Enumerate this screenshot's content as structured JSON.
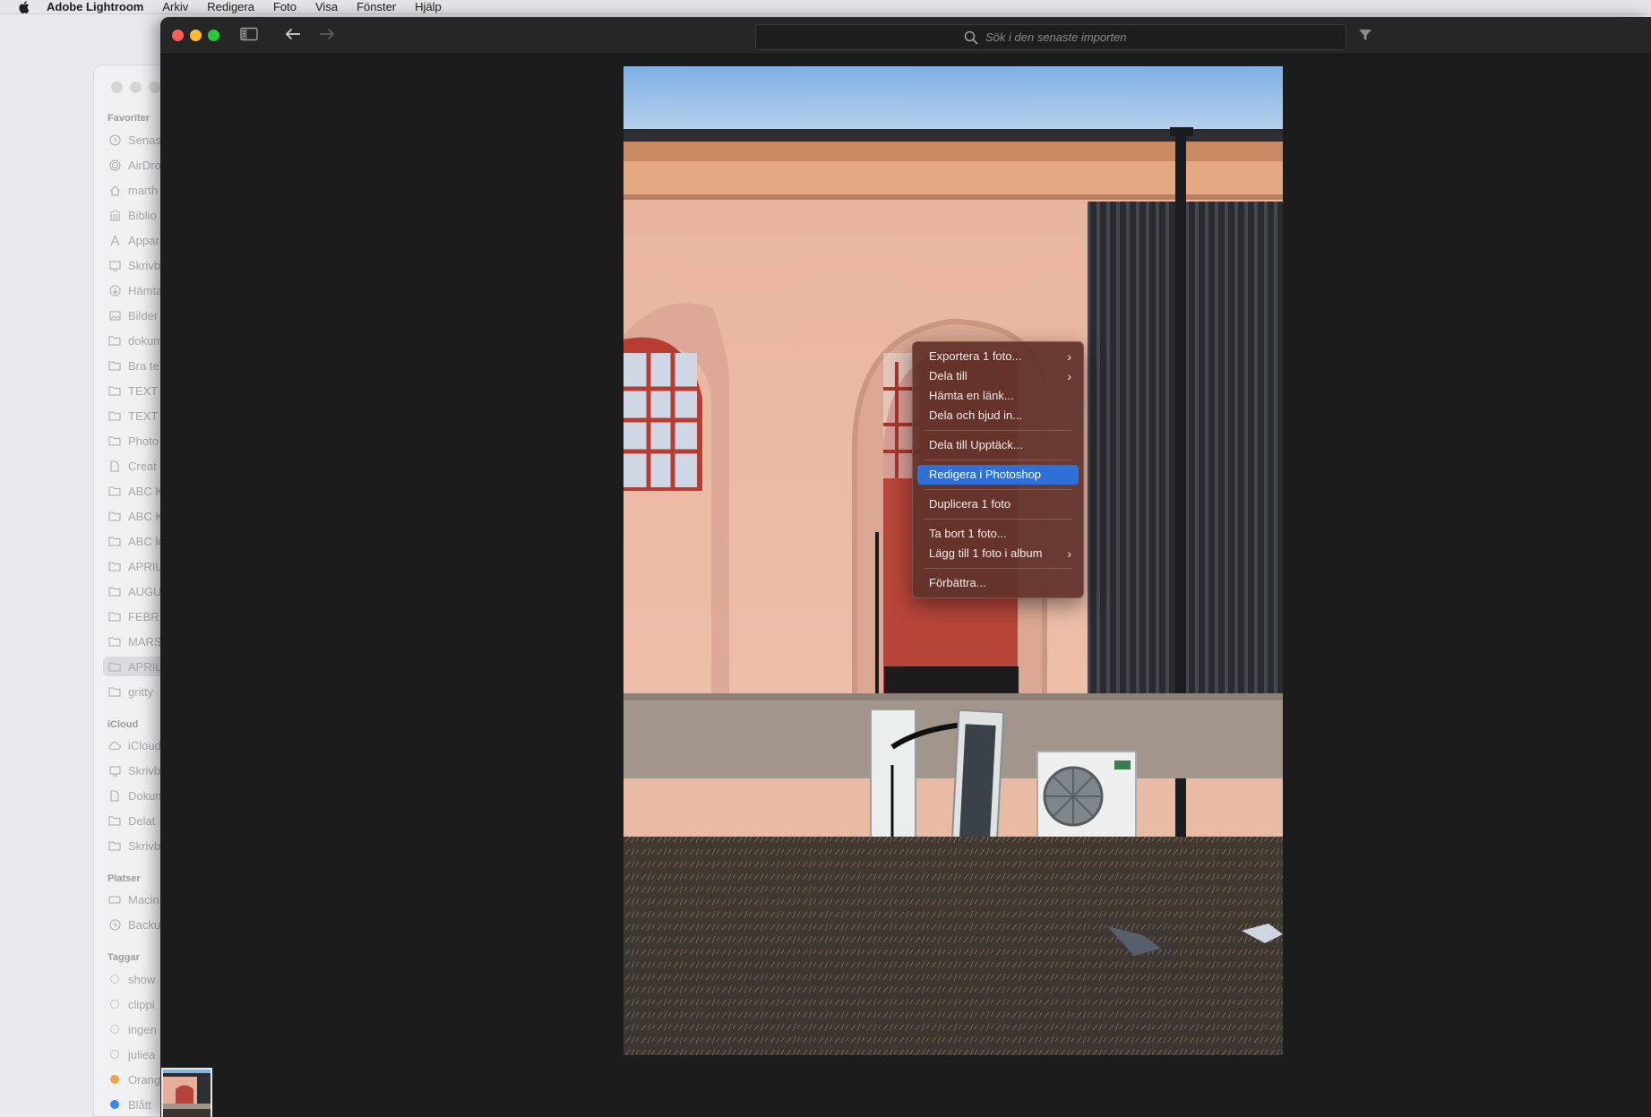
{
  "menubar": {
    "app_name": "Adobe Lightroom",
    "items": [
      "Arkiv",
      "Redigera",
      "Foto",
      "Visa",
      "Fönster",
      "Hjälp"
    ]
  },
  "finder": {
    "sections": {
      "favoriter": "Favoriter",
      "icloud": "iCloud",
      "platser": "Platser",
      "taggar": "Taggar"
    },
    "favorites": [
      "Senas",
      "AirDro",
      "marth",
      "Biblio",
      "Appar",
      "Skrivb",
      "Hämta",
      "Bilder",
      "dokum",
      "Bra te",
      "TEXT",
      "TEXT",
      "Photo",
      "Creat",
      "ABC K",
      "ABC K",
      "ABC k",
      "APRIL",
      "AUGU",
      "FEBR",
      "MARS",
      "APRIL",
      "gritty"
    ],
    "icloud_items": [
      "iCloud",
      "Skrivb",
      "Dokum",
      "Delat",
      "Skrivb"
    ],
    "places": [
      "Macin",
      "Backu"
    ],
    "tags": [
      {
        "label": "show",
        "color": "#c8c8cc"
      },
      {
        "label": "clippi",
        "color": "#c8c8cc"
      },
      {
        "label": "ingen",
        "color": "#c8c8cc"
      },
      {
        "label": "juliea",
        "color": "#c8c8cc"
      },
      {
        "label": "Orang",
        "color": "#f0a14a"
      },
      {
        "label": "Blått",
        "color": "#3b82f6"
      }
    ]
  },
  "lightroom": {
    "search_placeholder": "Sök i den senaste importen"
  },
  "context_menu": {
    "items": [
      {
        "label": "Exportera 1 foto...",
        "submenu": true
      },
      {
        "label": "Dela till",
        "submenu": true
      },
      {
        "label": "Hämta en länk...",
        "submenu": false
      },
      {
        "label": "Dela och bjud in...",
        "submenu": false
      },
      {
        "label": "Dela till Upptäck...",
        "submenu": false
      },
      {
        "label": "Redigera i Photoshop",
        "submenu": false,
        "highlighted": true
      },
      {
        "label": "Duplicera 1 foto",
        "submenu": false
      },
      {
        "label": "Ta bort 1 foto...",
        "submenu": false
      },
      {
        "label": "Lägg till 1 foto i album",
        "submenu": true
      },
      {
        "label": "Förbättra...",
        "submenu": false
      }
    ]
  },
  "colors": {
    "accent": "#2f6fd8",
    "menu_bg": "#60322a",
    "window_bg": "#1c1c1c"
  }
}
